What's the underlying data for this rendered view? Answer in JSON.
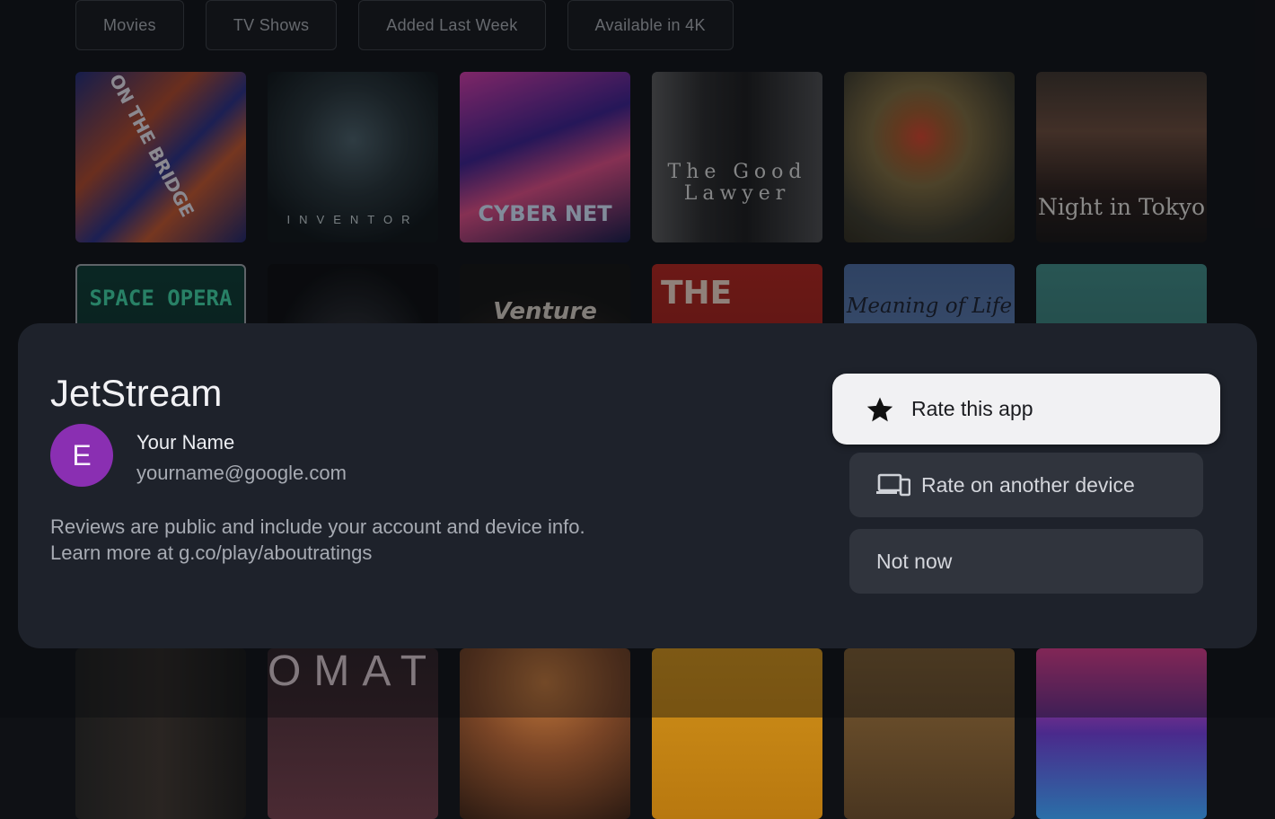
{
  "filters": [
    "Movies",
    "TV Shows",
    "Added Last Week",
    "Available in 4K"
  ],
  "row1": [
    {
      "title": "ON THE BRIDGE"
    },
    {
      "title": "INVENTOR"
    },
    {
      "title": "CYBER NET"
    },
    {
      "title": "The Good Lawyer"
    },
    {
      "title": ""
    },
    {
      "title": "Night in Tokyo"
    }
  ],
  "row2": [
    {
      "title": "SPACE OPERA"
    },
    {
      "title": ""
    },
    {
      "title": "Venture"
    },
    {
      "title": "THE"
    },
    {
      "title": "Meaning of Life"
    },
    {
      "title": ""
    }
  ],
  "row3": [
    {
      "title": ""
    },
    {
      "title": "OMAT"
    },
    {
      "title": ""
    },
    {
      "title": ""
    },
    {
      "title": ""
    },
    {
      "title": ""
    }
  ],
  "dialog": {
    "app_name": "JetStream",
    "avatar_letter": "E",
    "user_name": "Your Name",
    "user_email": "yourname@google.com",
    "notice": "Reviews are public and include your account and device info. Learn more at g.co/play/aboutratings",
    "rate_label": "Rate this app",
    "rate_other_label": "Rate on another device",
    "not_now_label": "Not now"
  },
  "colors": {
    "avatar": "#8a2fb2",
    "dialog_bg": "#1e222b",
    "primary_button": "#f1f1f3"
  }
}
